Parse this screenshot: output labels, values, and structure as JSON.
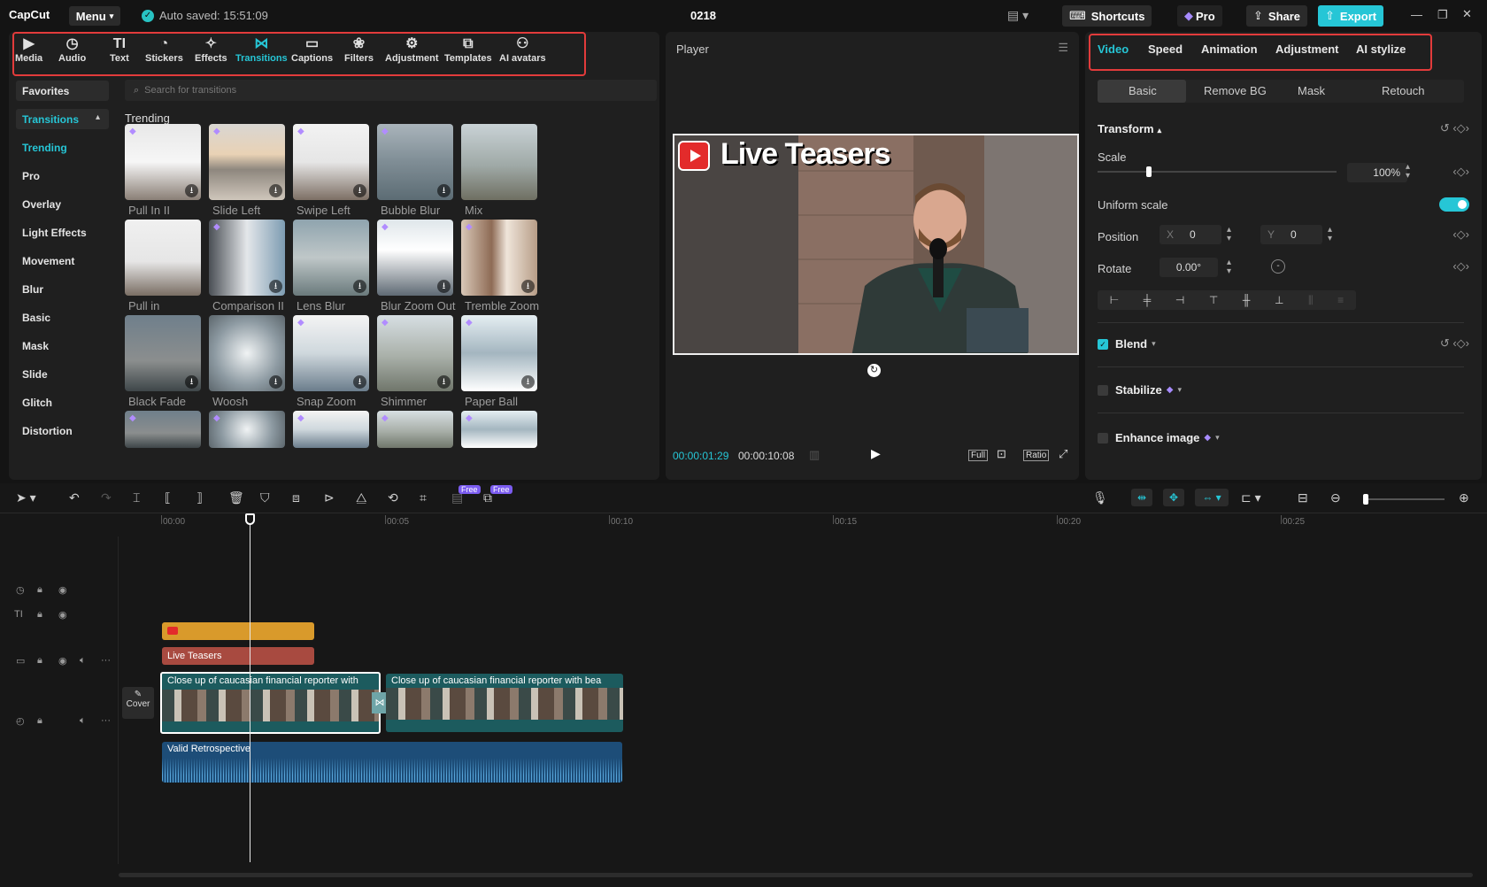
{
  "app": {
    "logo": "CapCut",
    "menu_label": "Menu",
    "autosave": "Auto saved: 15:51:09",
    "project_title": "0218",
    "shortcuts_label": "Shortcuts",
    "pro_label": "Pro",
    "share_label": "Share",
    "export_label": "Export"
  },
  "toolbar": {
    "tabs": [
      {
        "label": "Media",
        "icon": "▶"
      },
      {
        "label": "Audio",
        "icon": "◷"
      },
      {
        "label": "Text",
        "icon": "TI"
      },
      {
        "label": "Stickers",
        "icon": "◔"
      },
      {
        "label": "Effects",
        "icon": "✧"
      },
      {
        "label": "Transitions",
        "icon": "⋈"
      },
      {
        "label": "Captions",
        "icon": "▭"
      },
      {
        "label": "Filters",
        "icon": "❀"
      },
      {
        "label": "Adjustment",
        "icon": "⚙"
      },
      {
        "label": "Templates",
        "icon": "⧉"
      },
      {
        "label": "AI avatars",
        "icon": "⚇"
      }
    ]
  },
  "sidebar": {
    "favorites": "Favorites",
    "transitions": "Transitions",
    "items": [
      "Trending",
      "Pro",
      "Overlay",
      "Light Effects",
      "Movement",
      "Blur",
      "Basic",
      "Mask",
      "Slide",
      "Glitch",
      "Distortion"
    ]
  },
  "search": {
    "placeholder": "Search for transitions"
  },
  "section_title": "Trending",
  "transitions": [
    {
      "label": "Pull In II"
    },
    {
      "label": "Slide Left"
    },
    {
      "label": "Swipe Left"
    },
    {
      "label": "Bubble Blur"
    },
    {
      "label": "Mix"
    },
    {
      "label": "Pull in"
    },
    {
      "label": "Comparison II"
    },
    {
      "label": "Lens Blur"
    },
    {
      "label": "Blur Zoom Out"
    },
    {
      "label": "Tremble Zoom"
    },
    {
      "label": "Black Fade"
    },
    {
      "label": "Woosh"
    },
    {
      "label": "Snap Zoom"
    },
    {
      "label": "Shimmer"
    },
    {
      "label": "Paper Ball"
    }
  ],
  "player": {
    "title": "Player",
    "overlay_text": "Live Teasers",
    "current_time": "00:00:01:29",
    "total_time": "00:00:10:08",
    "full_label": "Full",
    "ratio_label": "Ratio"
  },
  "inspector": {
    "tabs": [
      "Video",
      "Speed",
      "Animation",
      "Adjustment",
      "AI stylize"
    ],
    "subtabs": [
      "Basic",
      "Remove BG",
      "Mask",
      "Retouch"
    ],
    "transform": "Transform",
    "scale_label": "Scale",
    "scale_value": "100%",
    "uniform_scale": "Uniform scale",
    "position_label": "Position",
    "x_label": "X",
    "x_value": "0",
    "y_label": "Y",
    "y_value": "0",
    "rotate_label": "Rotate",
    "rotate_value": "0.00°",
    "blend": "Blend",
    "stabilize": "Stabilize",
    "enhance": "Enhance image"
  },
  "timeline": {
    "free_badge": "Free",
    "ruler": [
      "00:00",
      "00:05",
      "00:10",
      "00:15",
      "00:20",
      "00:25"
    ],
    "cover_label": "Cover",
    "text_clip": "Live Teasers",
    "video_clip_1": "Close up of caucasian financial reporter with",
    "video_clip_2": "Close up of caucasian financial reporter with bea",
    "audio_clip": "Valid Retrospective"
  },
  "colors": {
    "accent": "#26c6d6",
    "highlight_box": "#e23b3b",
    "sticker_clip": "#d99a2b",
    "text_clip": "#a84a40",
    "video_clip": "#1c5b5e",
    "audio_clip": "#1d4d78"
  }
}
